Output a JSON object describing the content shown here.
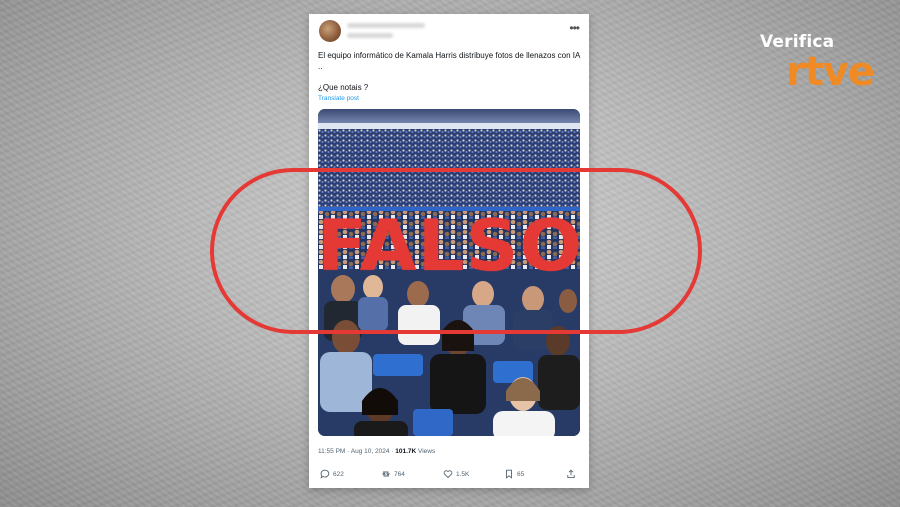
{
  "brand": {
    "verifica": "Verifica",
    "rtve": "rtve",
    "accent_color": "#f08a24"
  },
  "post": {
    "text": "El equipo informático de Kamala Harris distribuye fotos de llenazos con IA ..",
    "question": "¿Que notais ?",
    "translate_label": "Translate post",
    "image_icon": "stadium-crowd-photo",
    "meta": {
      "time": "11:55 PM · Aug 10, 2024 · ",
      "views_count": "101.7K",
      "views_label": " Views"
    },
    "actions": {
      "replies": "622",
      "reposts": "764",
      "likes": "1.5K",
      "bookmarks": "65"
    }
  },
  "overlay": {
    "label": "FALSO",
    "color": "#e53935"
  }
}
